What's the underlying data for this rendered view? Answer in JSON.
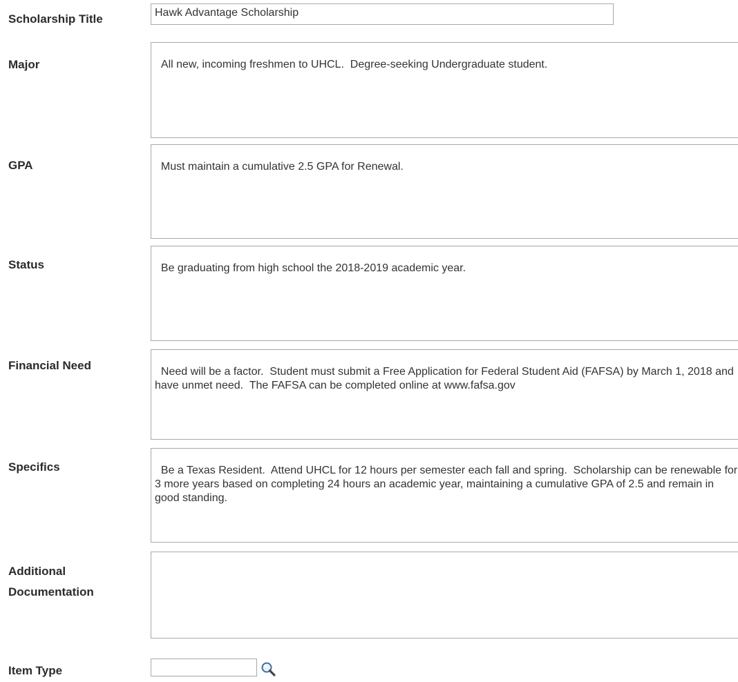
{
  "form": {
    "scholarship_title": {
      "label": "Scholarship Title",
      "value": "Hawk Advantage Scholarship"
    },
    "major": {
      "label": "Major",
      "value": "All new, incoming freshmen to UHCL.  Degree-seeking Undergraduate student."
    },
    "gpa": {
      "label": "GPA",
      "value": "Must maintain a cumulative 2.5 GPA for Renewal."
    },
    "status": {
      "label": "Status",
      "value": "Be graduating from high school the 2018-2019 academic year."
    },
    "financial_need": {
      "label": "Financial Need",
      "value": "Need will be a factor.  Student must submit a Free Application for Federal Student Aid (FAFSA) by March 1, 2018 and have unmet need.  The FAFSA can be completed online at www.fafsa.gov"
    },
    "specifics": {
      "label": "Specifics",
      "value": "Be a Texas Resident.  Attend UHCL for 12 hours per semester each fall and spring.  Scholarship can be renewable for 3 more years based on completing 24 hours an academic year, maintaining a cumulative GPA of 2.5 and remain in good standing."
    },
    "additional_documentation": {
      "label_line1": "Additional",
      "label_line2": "Documentation",
      "value": ""
    },
    "item_type": {
      "label": "Item Type",
      "value": "",
      "lookup_icon": "magnifier-icon"
    }
  }
}
